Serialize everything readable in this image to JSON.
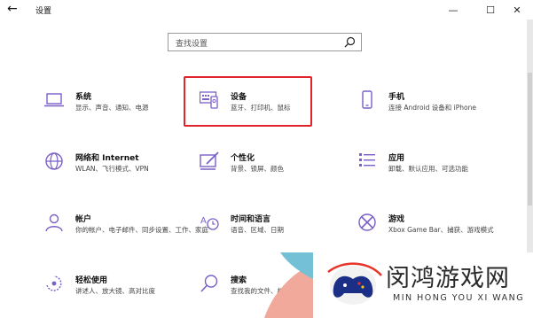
{
  "window": {
    "back_glyph": "←",
    "title": "设置",
    "minimize_glyph": "—",
    "maximize_glyph": "☐",
    "close_glyph": "✕"
  },
  "search": {
    "placeholder": "查找设置"
  },
  "settings": [
    {
      "key": "system",
      "title": "系统",
      "desc": "显示、声音、通知、电源",
      "icon": "laptop-icon"
    },
    {
      "key": "devices",
      "title": "设备",
      "desc": "蓝牙、打印机、鼠标",
      "icon": "keyboard-devices-icon",
      "highlighted": true
    },
    {
      "key": "phone",
      "title": "手机",
      "desc": "连接 Android 设备和 iPhone",
      "icon": "phone-icon"
    },
    {
      "key": "network",
      "title": "网络和 Internet",
      "desc": "WLAN、飞行模式、VPN",
      "icon": "globe-icon"
    },
    {
      "key": "personalization",
      "title": "个性化",
      "desc": "背景、锁屏、颜色",
      "icon": "paint-icon"
    },
    {
      "key": "apps",
      "title": "应用",
      "desc": "卸载、默认应用、可选功能",
      "icon": "apps-list-icon"
    },
    {
      "key": "accounts",
      "title": "帐户",
      "desc": "你的帐户、电子邮件、同步设置、工作、家庭",
      "icon": "person-icon"
    },
    {
      "key": "time",
      "title": "时间和语言",
      "desc": "语音、区域、日期",
      "icon": "time-language-icon"
    },
    {
      "key": "gaming",
      "title": "游戏",
      "desc": "Xbox Game Bar、捕获、游戏模式",
      "icon": "xbox-icon"
    },
    {
      "key": "ease",
      "title": "轻松使用",
      "desc": "讲述人、放大镜、高对比度",
      "icon": "ease-of-access-icon"
    },
    {
      "key": "search",
      "title": "搜索",
      "desc": "查找我的文件、权限",
      "icon": "search-icon"
    }
  ],
  "watermark": {
    "name": "闵鸿游戏网",
    "sub": "MIN HONG YOU XI WANG"
  },
  "colors": {
    "accent": "#7a5fc7",
    "highlight": "#e0242a"
  }
}
